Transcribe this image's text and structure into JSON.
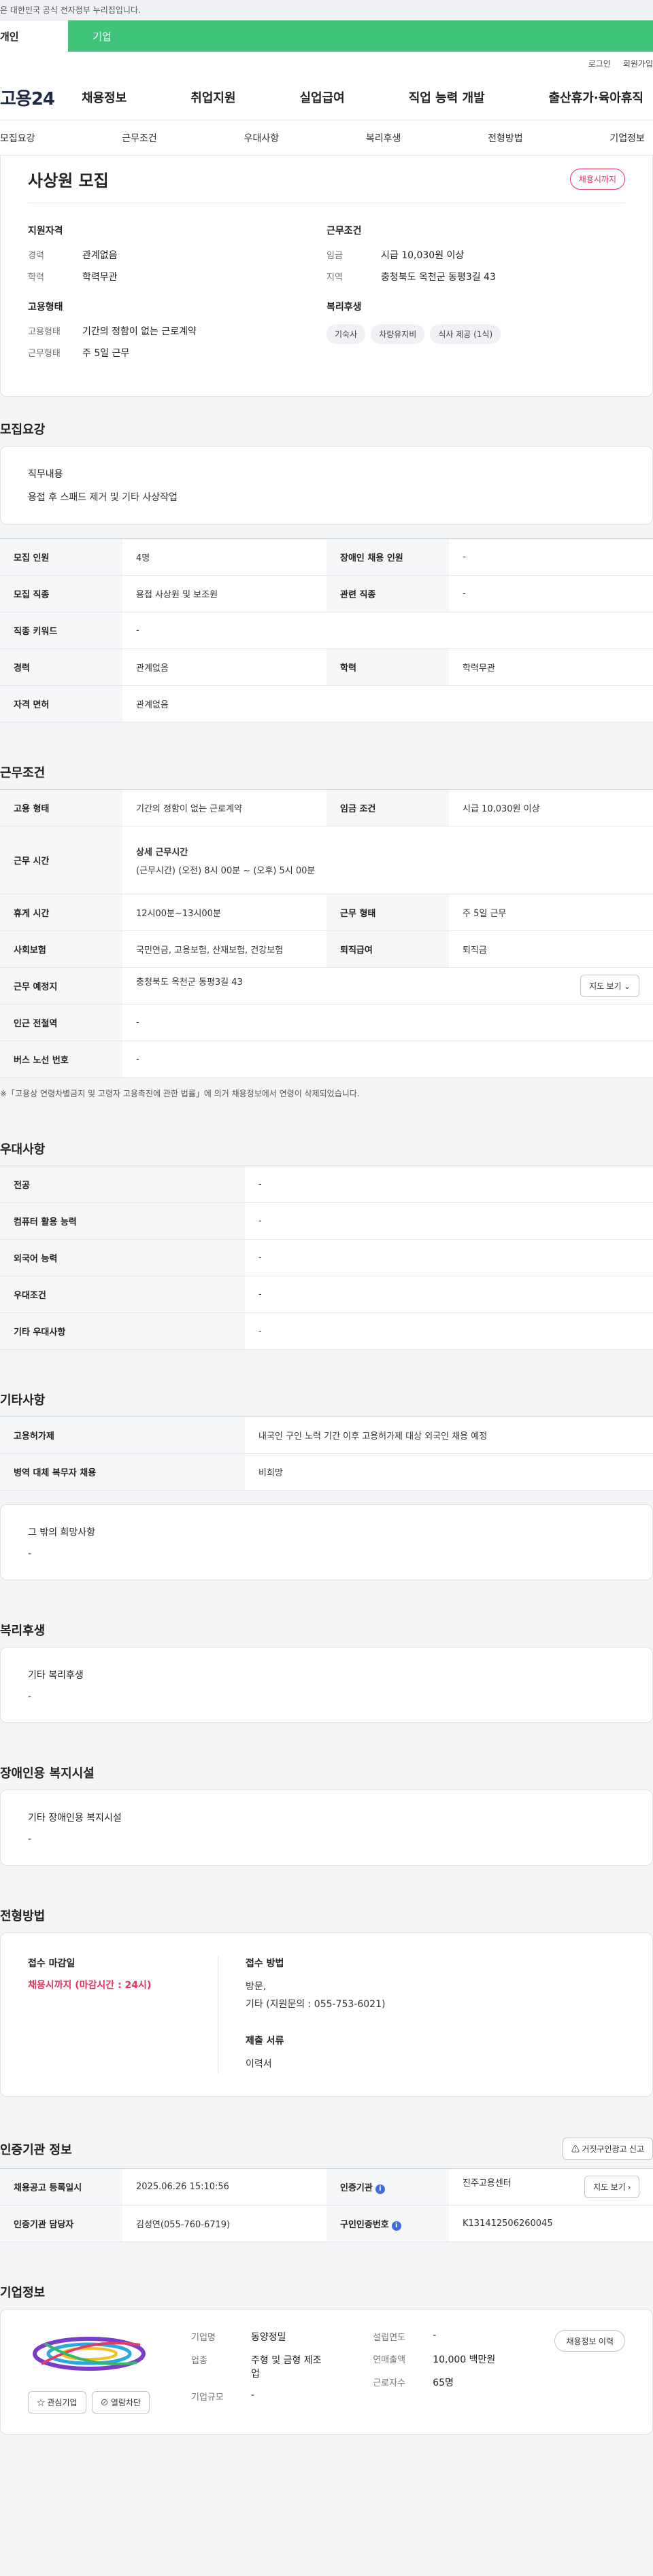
{
  "gov_banner": "이 누리집은 대한민국 공식 전자정부 누리집입니다.",
  "user_tabs": {
    "personal": "개인",
    "business": "기업"
  },
  "header": {
    "login": "로그인",
    "signup": "회원가입",
    "logo": "고용24",
    "gnb": [
      "채용정보",
      "취업지원",
      "실업급여",
      "직업 능력 개발",
      "출산휴가·육아휴직"
    ]
  },
  "subnav": [
    "모집요강",
    "근무조건",
    "우대사항",
    "복리후생",
    "전형방법",
    "기업정보"
  ],
  "job": {
    "title": "사상원 모집",
    "status_badge": "채용시까지",
    "qualification": {
      "head": "지원자격",
      "career_k": "경력",
      "career_v": "관계없음",
      "edu_k": "학력",
      "edu_v": "학력무관"
    },
    "employment": {
      "head": "고용형태",
      "type_k": "고용형태",
      "type_v": "기간의 정함이 없는 근로계약",
      "days_k": "근무형태",
      "days_v": "주 5일 근무"
    },
    "conditions": {
      "head": "근무조건",
      "wage_k": "임금",
      "wage_v": "시급 10,030원 이상",
      "area_k": "지역",
      "area_v": "충청북도 옥천군 동평3길 43"
    },
    "welfare": {
      "head": "복리후생",
      "chips": [
        "기숙사",
        "차량유지비",
        "식사 제공 (1식)"
      ]
    }
  },
  "recruit": {
    "title": "모집요강",
    "duty_label": "직무내용",
    "duty_value": "용접 후 스패드 제거 및 기타 사상작업",
    "rows": {
      "count_k": "모집 인원",
      "count_v": "4명",
      "disabled_k": "장애인 채용 인원",
      "disabled_v": "-",
      "job_k": "모집 직종",
      "job_v": "용접 사상원 및 보조원",
      "related_k": "관련 직종",
      "related_v": "-",
      "keyword_k": "직종 키워드",
      "keyword_v": "-",
      "career_k": "경력",
      "career_v": "관계없음",
      "edu_k": "학력",
      "edu_v": "학력무관",
      "license_k": "자격 면허",
      "license_v": "관계없음"
    }
  },
  "work": {
    "title": "근무조건",
    "type_k": "고용 형태",
    "type_v": "기간의 정함이 없는 근로계약",
    "wage_k": "임금 조건",
    "wage_v": "시급 10,030원 이상",
    "time_k": "근무 시간",
    "time_lab": "상세 근무시간",
    "time_v": "(근무시간) (오전) 8시 00분 ~ (오후) 5시 00분",
    "rest_k": "휴게 시간",
    "rest_v": "12시00분~13시00분",
    "form_k": "근무 형태",
    "form_v": "주 5일 근무",
    "insurance_k": "사회보험",
    "insurance_v": "국민연금, 고용보험, 산재보험, 건강보험",
    "retire_k": "퇴직급여",
    "retire_v": "퇴직금",
    "place_k": "근무 예정지",
    "place_v": "충청북도 옥천군 동평3길 43",
    "map_btn": "지도 보기",
    "station_k": "인근 전철역",
    "station_v": "-",
    "bus_k": "버스 노선 번호",
    "bus_v": "-",
    "note": "※「고용상 연령차별금지 및 고령자 고용촉진에 관한 법률」에 의거 채용정보에서 연령이 삭제되었습니다."
  },
  "prefer": {
    "title": "우대사항",
    "rows": [
      {
        "k": "전공",
        "v": "-"
      },
      {
        "k": "컴퓨터 활용 능력",
        "v": "-"
      },
      {
        "k": "외국어 능력",
        "v": "-"
      },
      {
        "k": "우대조건",
        "v": "-"
      },
      {
        "k": "기타 우대사항",
        "v": "-"
      }
    ]
  },
  "etc": {
    "title": "기타사항",
    "foreign_k": "고용허가제",
    "foreign_v": "내국인 구인 노력 기간 이후 고용허가제 대상 외국인 채용 예정",
    "military_k": "병역 대체 복무자 채용",
    "military_v": "비희망",
    "other_lab": "그 밖의 희망사항",
    "other_v": "-"
  },
  "welfare": {
    "title": "복리후생",
    "lab": "기타 복리후생",
    "v": "-"
  },
  "facility": {
    "title": "장애인용 복지시설",
    "lab": "기타 장애인용 복지시설",
    "v": "-"
  },
  "apply": {
    "title": "전형방법",
    "deadline_lab": "접수 마감일",
    "deadline_v": "채용시까지 (마감시간 : 24시)",
    "method_lab": "접수 방법",
    "method_v1": "방문,",
    "method_v2": "기타 (지원문의 : 055-753-6021)",
    "docs_lab": "제출 서류",
    "docs_v": "이력서"
  },
  "cert": {
    "title": "인증기관 정보",
    "report_btn": "거짓구인광고 신고",
    "reg_k": "채용공고 등록일시",
    "reg_v": "2025.06.26 15:10:56",
    "org_k": "인증기관",
    "org_v": "진주고용센터",
    "map_btn": "지도 보기",
    "manager_k": "인증기관 담당자",
    "manager_v": "김성연(055-760-6719)",
    "no_k": "구인인증번호",
    "no_v": "K131412506260045"
  },
  "company": {
    "title": "기업정보",
    "fav_btn": "관심기업",
    "block_btn": "열람차단",
    "name_k": "기업명",
    "name_v": "동양정밀",
    "industry_k": "업종",
    "industry_v": "주형 및 금형 제조업",
    "size_k": "기업규모",
    "size_v": "-",
    "founded_k": "설립연도",
    "founded_v": "-",
    "revenue_k": "연매출액",
    "revenue_v": "10,000 백만원",
    "staff_k": "근로자수",
    "staff_v": "65명",
    "history_btn": "채용정보 이력"
  },
  "colors": {
    "accent_green": "#3fc47a",
    "closed_red": "#e6325a",
    "info_blue": "#3b6fe0"
  }
}
